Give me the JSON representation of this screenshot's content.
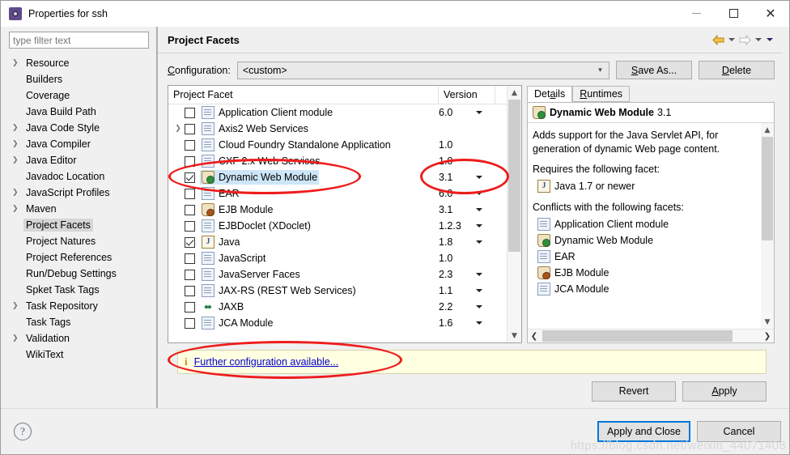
{
  "window": {
    "title": "Properties for ssh",
    "icon": "eclipse-properties-icon",
    "minimize": "—",
    "maximize": "□",
    "close": "✕"
  },
  "sidebar": {
    "filter_placeholder": "type filter text",
    "filter_value": "",
    "items": [
      {
        "label": "Resource",
        "expandable": true,
        "selected": false
      },
      {
        "label": "Builders",
        "expandable": false,
        "selected": false
      },
      {
        "label": "Coverage",
        "expandable": false,
        "selected": false
      },
      {
        "label": "Java Build Path",
        "expandable": false,
        "selected": false
      },
      {
        "label": "Java Code Style",
        "expandable": true,
        "selected": false
      },
      {
        "label": "Java Compiler",
        "expandable": true,
        "selected": false
      },
      {
        "label": "Java Editor",
        "expandable": true,
        "selected": false
      },
      {
        "label": "Javadoc Location",
        "expandable": false,
        "selected": false
      },
      {
        "label": "JavaScript Profiles",
        "expandable": true,
        "selected": false
      },
      {
        "label": "Maven",
        "expandable": true,
        "selected": false
      },
      {
        "label": "Project Facets",
        "expandable": false,
        "selected": true
      },
      {
        "label": "Project Natures",
        "expandable": false,
        "selected": false
      },
      {
        "label": "Project References",
        "expandable": false,
        "selected": false
      },
      {
        "label": "Run/Debug Settings",
        "expandable": false,
        "selected": false
      },
      {
        "label": "Spket Task Tags",
        "expandable": false,
        "selected": false
      },
      {
        "label": "Task Repository",
        "expandable": true,
        "selected": false
      },
      {
        "label": "Task Tags",
        "expandable": false,
        "selected": false
      },
      {
        "label": "Validation",
        "expandable": true,
        "selected": false
      },
      {
        "label": "WikiText",
        "expandable": false,
        "selected": false
      }
    ]
  },
  "page": {
    "title": "Project Facets",
    "nav": {
      "back_icon": "back-arrow-icon",
      "back_menu_icon": "chevron-down-icon",
      "forward_icon": "forward-arrow-icon",
      "forward_menu_icon": "chevron-down-icon",
      "view_menu_icon": "chevron-down-icon"
    },
    "configuration_label": "Configuration:",
    "configuration_value": "<custom>",
    "save_as_label": "Save As...",
    "delete_label": "Delete"
  },
  "facet_table": {
    "columns": [
      "Project Facet",
      "Version"
    ],
    "rows": [
      {
        "label": "Application Client module",
        "version": "6.0",
        "checked": false,
        "expandable": false,
        "icon": "doc-icon",
        "has_version_dropdown": true,
        "selected": false
      },
      {
        "label": "Axis2 Web Services",
        "version": "",
        "checked": false,
        "expandable": true,
        "icon": "doc-icon",
        "has_version_dropdown": false,
        "selected": false
      },
      {
        "label": "Cloud Foundry Standalone Application",
        "version": "1.0",
        "checked": false,
        "expandable": false,
        "icon": "doc-icon",
        "has_version_dropdown": false,
        "selected": false
      },
      {
        "label": "CXF 2.x Web Services",
        "version": "1.0",
        "checked": false,
        "expandable": false,
        "icon": "doc-icon",
        "has_version_dropdown": false,
        "selected": false
      },
      {
        "label": "Dynamic Web Module",
        "version": "3.1",
        "checked": true,
        "expandable": false,
        "icon": "jar-web-icon",
        "has_version_dropdown": true,
        "selected": true
      },
      {
        "label": "EAR",
        "version": "6.0",
        "checked": false,
        "expandable": false,
        "icon": "doc-icon",
        "has_version_dropdown": true,
        "selected": false
      },
      {
        "label": "EJB Module",
        "version": "3.1",
        "checked": false,
        "expandable": false,
        "icon": "jar-bean-icon",
        "has_version_dropdown": true,
        "selected": false
      },
      {
        "label": "EJBDoclet (XDoclet)",
        "version": "1.2.3",
        "checked": false,
        "expandable": false,
        "icon": "doc-icon",
        "has_version_dropdown": true,
        "selected": false
      },
      {
        "label": "Java",
        "version": "1.8",
        "checked": true,
        "expandable": false,
        "icon": "java-icon",
        "has_version_dropdown": true,
        "selected": false
      },
      {
        "label": "JavaScript",
        "version": "1.0",
        "checked": false,
        "expandable": false,
        "icon": "doc-icon",
        "has_version_dropdown": false,
        "selected": false
      },
      {
        "label": "JavaServer Faces",
        "version": "2.3",
        "checked": false,
        "expandable": false,
        "icon": "doc-icon",
        "has_version_dropdown": true,
        "selected": false
      },
      {
        "label": "JAX-RS (REST Web Services)",
        "version": "1.1",
        "checked": false,
        "expandable": false,
        "icon": "doc-icon",
        "has_version_dropdown": true,
        "selected": false
      },
      {
        "label": "JAXB",
        "version": "2.2",
        "checked": false,
        "expandable": false,
        "icon": "jaxb-icon",
        "has_version_dropdown": true,
        "selected": false
      },
      {
        "label": "JCA Module",
        "version": "1.6",
        "checked": false,
        "expandable": false,
        "icon": "doc-icon",
        "has_version_dropdown": true,
        "selected": false
      }
    ],
    "scroll_up_icon": "chevron-up-icon",
    "scroll_down_icon": "chevron-down-icon"
  },
  "details": {
    "tabs": [
      {
        "label": "Details",
        "active": true
      },
      {
        "label": "Runtimes",
        "active": false
      }
    ],
    "heading_name": "Dynamic Web Module",
    "heading_version": "3.1",
    "heading_icon": "jar-web-icon",
    "description": "Adds support for the Java Servlet API, for generation of dynamic Web page content.",
    "requires_title": "Requires the following facet:",
    "requires": [
      {
        "label": "Java 1.7 or newer",
        "icon": "java-icon"
      }
    ],
    "conflicts_title": "Conflicts with the following facets:",
    "conflicts": [
      {
        "label": "Application Client module",
        "icon": "doc-icon"
      },
      {
        "label": "Dynamic Web Module",
        "icon": "jar-web-icon"
      },
      {
        "label": "EAR",
        "icon": "doc-icon"
      },
      {
        "label": "EJB Module",
        "icon": "jar-bean-icon"
      },
      {
        "label": "JCA Module",
        "icon": "doc-icon"
      }
    ],
    "hscroll_left_icon": "chevron-left-icon",
    "hscroll_right_icon": "chevron-right-icon"
  },
  "info_bar": {
    "icon": "info-icon",
    "link_text": "Further configuration available..."
  },
  "actions": {
    "revert_label": "Revert",
    "apply_label": "Apply"
  },
  "footer": {
    "help_icon": "help-icon",
    "apply_and_close_label": "Apply and Close",
    "cancel_label": "Cancel",
    "watermark": "https://blog.csdn.net/weixin_44071408"
  },
  "annotations": {
    "accent_color": "#ee1c1c",
    "ellipses": [
      "facet-row-highlight",
      "version-cell-highlight",
      "further-config-link-highlight"
    ]
  }
}
